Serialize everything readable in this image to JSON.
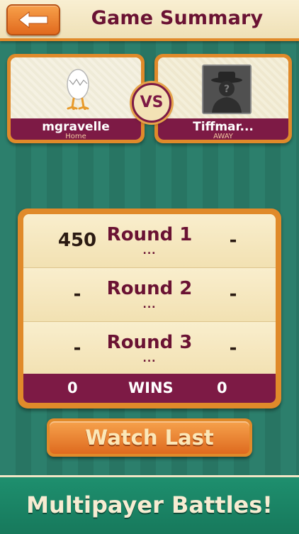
{
  "header": {
    "title": "Game Summary",
    "back_icon": "back-arrow-icon"
  },
  "players": {
    "home": {
      "name": "mgravelle",
      "role": "Home",
      "avatar": "egg-avatar-icon"
    },
    "away": {
      "name": "Tiffmar...",
      "role": "AWAY",
      "avatar": "unknown-player-icon"
    },
    "vs_label": "VS"
  },
  "rounds": [
    {
      "label": "Round 1",
      "status": "...",
      "home_score": "450",
      "away_score": "-"
    },
    {
      "label": "Round 2",
      "status": "...",
      "home_score": "-",
      "away_score": "-"
    },
    {
      "label": "Round 3",
      "status": "...",
      "home_score": "-",
      "away_score": "-"
    }
  ],
  "wins": {
    "label": "WINS",
    "home": "0",
    "away": "0"
  },
  "watch_button": {
    "label": "Watch Last"
  },
  "banner": {
    "text": "Multipayer Battles!"
  },
  "colors": {
    "accent_orange": "#e08a2a",
    "maroon": "#7d1a45",
    "background_green": "#2a7a68"
  }
}
